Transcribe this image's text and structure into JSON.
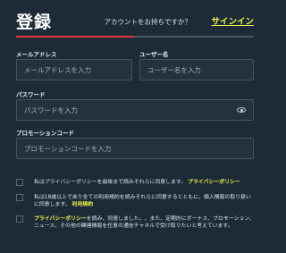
{
  "header": {
    "title": "登録",
    "account_question": "アカウントをお持ちですか？",
    "signin_link": "サインイン"
  },
  "form": {
    "email": {
      "label": "メールアドレス",
      "placeholder": "メールアドレスを入力"
    },
    "username": {
      "label": "ユーザー名",
      "placeholder": "ユーザー名を入力"
    },
    "password": {
      "label": "パスワード",
      "placeholder": "パスワードを入力"
    },
    "promo": {
      "label": "プロモーションコード",
      "placeholder": "プロモーションコードを入力"
    }
  },
  "consents": [
    {
      "text": "私はプライバシーポリシーを最後まで読みそれらに同意します。",
      "link": "プライバシーポリシー",
      "suffix": ""
    },
    {
      "text": "私は18歳以上であり全ての利用規約を読みそれらに同意するとともに、個人情報の取り扱いに同意します。",
      "link": "利用規約",
      "suffix": ""
    },
    {
      "text": "を読み、同意しました。",
      "link": "プライバシーポリシー",
      "suffix": "、また、定期的にボーナス、プロモーション、ニュース、その他の関連情報を任意の通信チャネルで受け取りたいと考えています。"
    }
  ],
  "colors": {
    "background": "#1d2a38",
    "accent_red": "#e0383e",
    "link_yellow": "#eef34a"
  },
  "icons": {
    "password_toggle": "eye-icon"
  }
}
